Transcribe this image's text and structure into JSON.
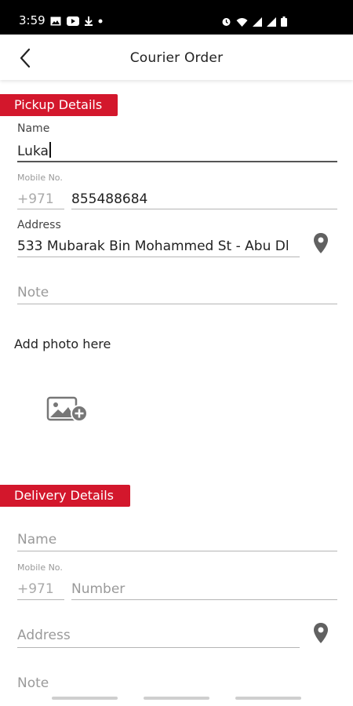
{
  "status_bar": {
    "time": "3:59",
    "left_icons": [
      "gallery-icon",
      "youtube-icon",
      "download-icon",
      "dot-icon"
    ],
    "right_icons": [
      "alarm-icon",
      "wifi-icon",
      "signal-icon",
      "signal-icon",
      "battery-icon"
    ]
  },
  "app_bar": {
    "title": "Courier Order",
    "back_icon": "back-arrow-icon"
  },
  "pickup": {
    "section_title": "Pickup Details",
    "name_label": "Name",
    "name_value": "Luka",
    "mobile_label": "Mobile No.",
    "mobile_prefix": "+971",
    "mobile_value": "855488684",
    "address_label": "Address",
    "address_value": "533 Mubarak Bin Mohammed St - Abu Dl",
    "note_placeholder": "Note",
    "add_photo_label": "Add photo here",
    "location_icon": "location-pin-icon",
    "photo_icon": "add-photo-icon"
  },
  "delivery": {
    "section_title": "Delivery Details",
    "name_placeholder": "Name",
    "mobile_label": "Mobile No.",
    "mobile_prefix": "+971",
    "mobile_placeholder": "Number",
    "address_placeholder": "Address",
    "note_placeholder": "Note",
    "location_icon": "location-pin-icon"
  },
  "colors": {
    "accent": "#d3172c",
    "status_bar": "#000000",
    "placeholder": "#9a9a9a"
  }
}
